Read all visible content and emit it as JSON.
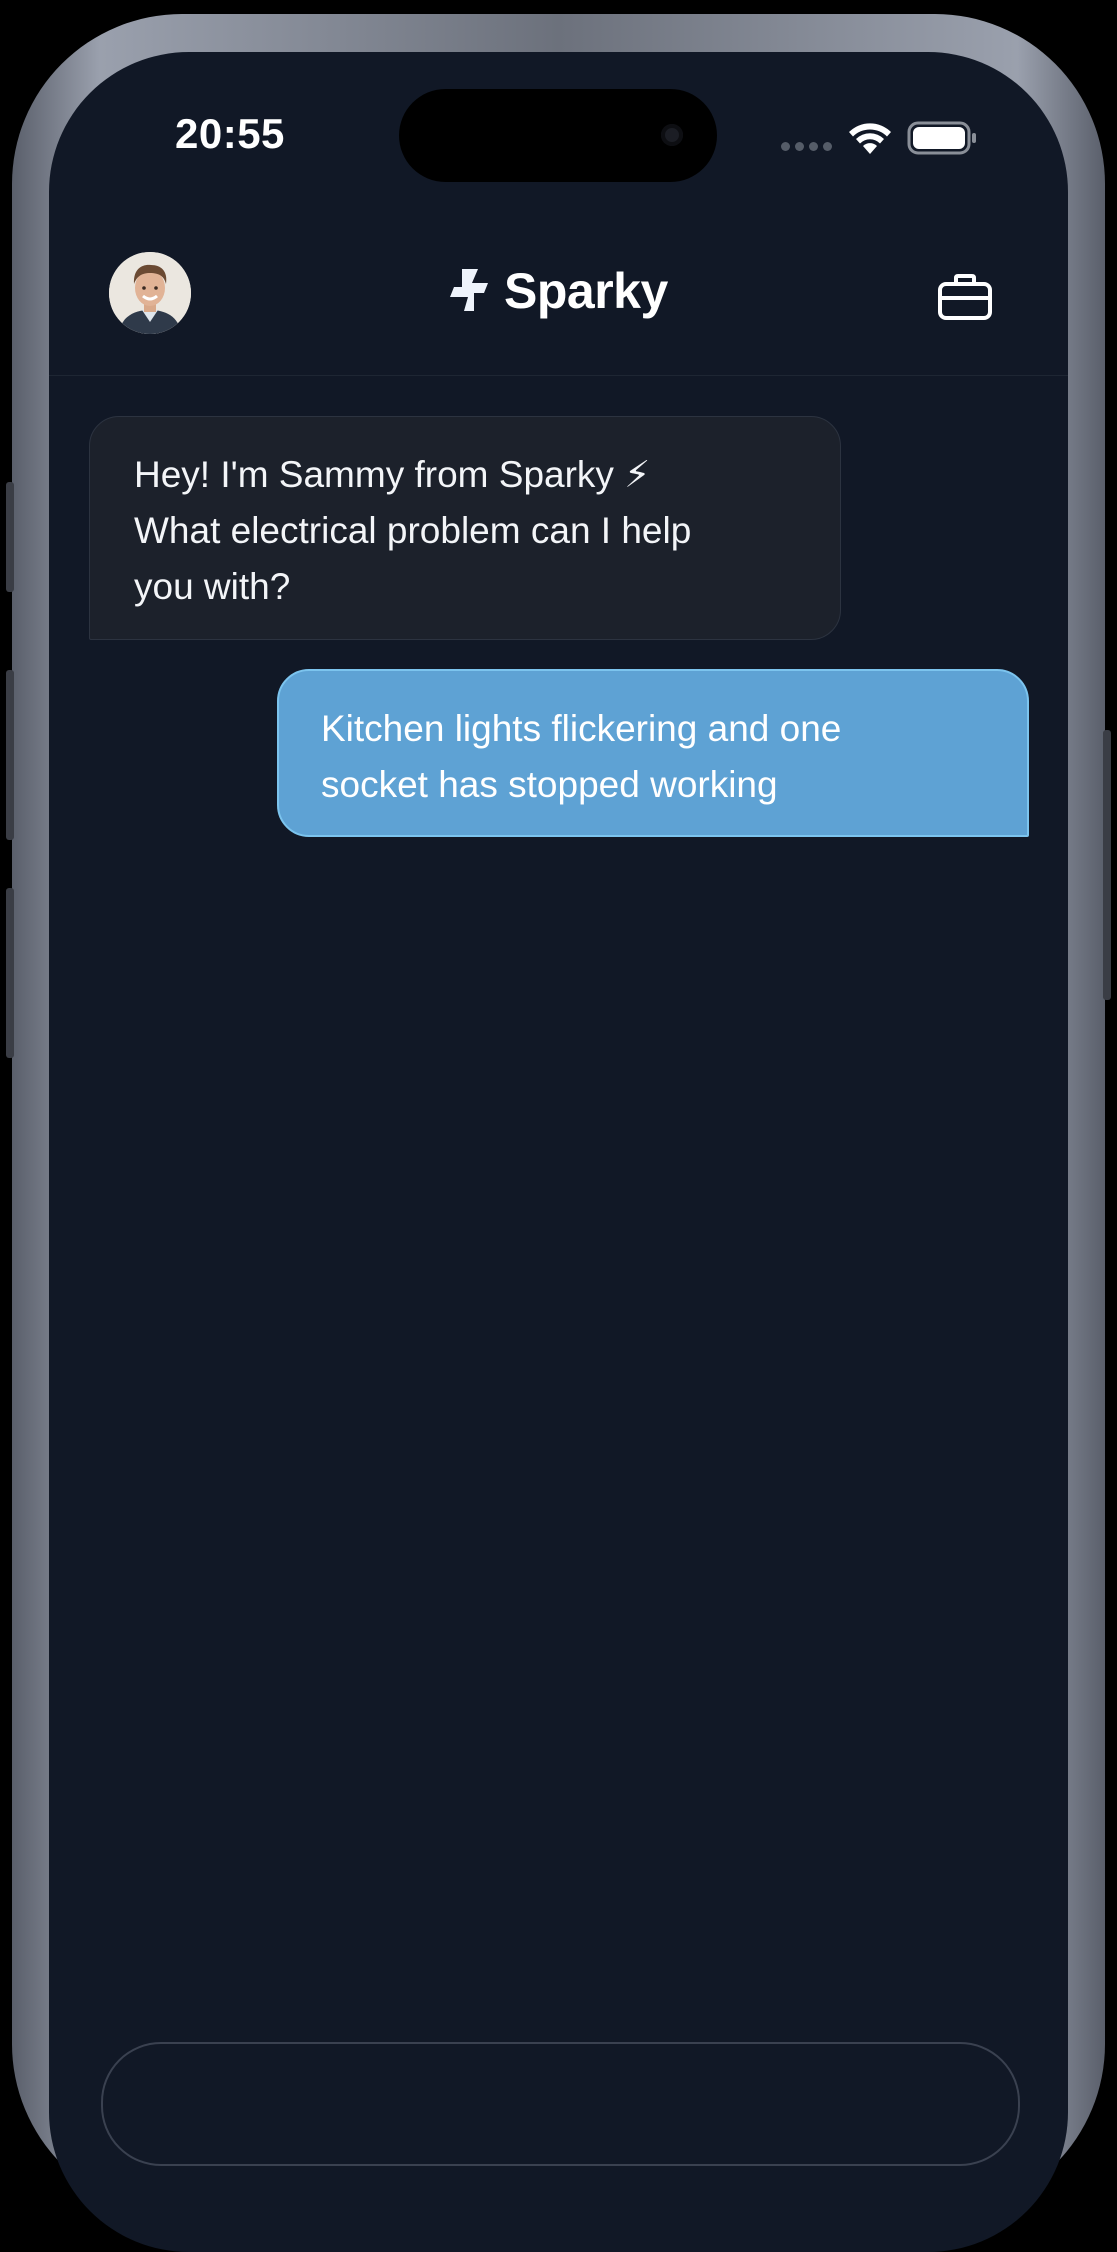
{
  "status_bar": {
    "time": "20:55"
  },
  "header": {
    "brand_name": "Sparky",
    "avatar_alt": "Sammy avatar"
  },
  "messages": [
    {
      "role": "assistant",
      "text": "Hey! I'm Sammy from Sparky ⚡\nWhat electrical problem can I help\nyou with?"
    },
    {
      "role": "user",
      "text": "Kitchen lights flickering and one\nsocket has stopped working"
    }
  ],
  "colors": {
    "background": "#111826",
    "bot_bubble": "#1c212b",
    "user_bubble": "#5ea2d4",
    "text": "#f3f5f8"
  },
  "icons": {
    "brand": "lightning-bolt-icon",
    "right_action": "briefcase-icon"
  }
}
